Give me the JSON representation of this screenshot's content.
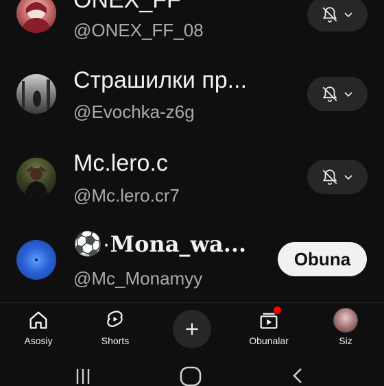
{
  "subscriptions": [
    {
      "name": "ONEX_FF",
      "handle": "@ONEX_FF_08",
      "action": "bell"
    },
    {
      "name": "Страшилки пр...",
      "handle": "@Evochka-z6g",
      "action": "bell"
    },
    {
      "name": "Mc.lero.c",
      "handle": "@Mc.lero.cr7",
      "action": "bell"
    },
    {
      "name_prefix": "⚽·",
      "name": "𝐌𝐨𝐧𝐚_𝐰𝐚...",
      "handle": "@Mc_Monamyy",
      "action": "subscribe",
      "action_label": "Obuna"
    }
  ],
  "nav": {
    "home": "Asosiy",
    "shorts": "Shorts",
    "subscriptions": "Obunalar",
    "you": "Siz"
  },
  "colors": {
    "background": "#0f0f0f",
    "button_bg": "#272727",
    "notification_dot": "#ff0000",
    "secondary_text": "#aaaaaa"
  },
  "icons": [
    "bell-off-icon",
    "chevron-down-icon",
    "home-icon",
    "shorts-icon",
    "plus-icon",
    "subscriptions-icon",
    "recents-icon",
    "home-circle-icon",
    "back-icon"
  ]
}
